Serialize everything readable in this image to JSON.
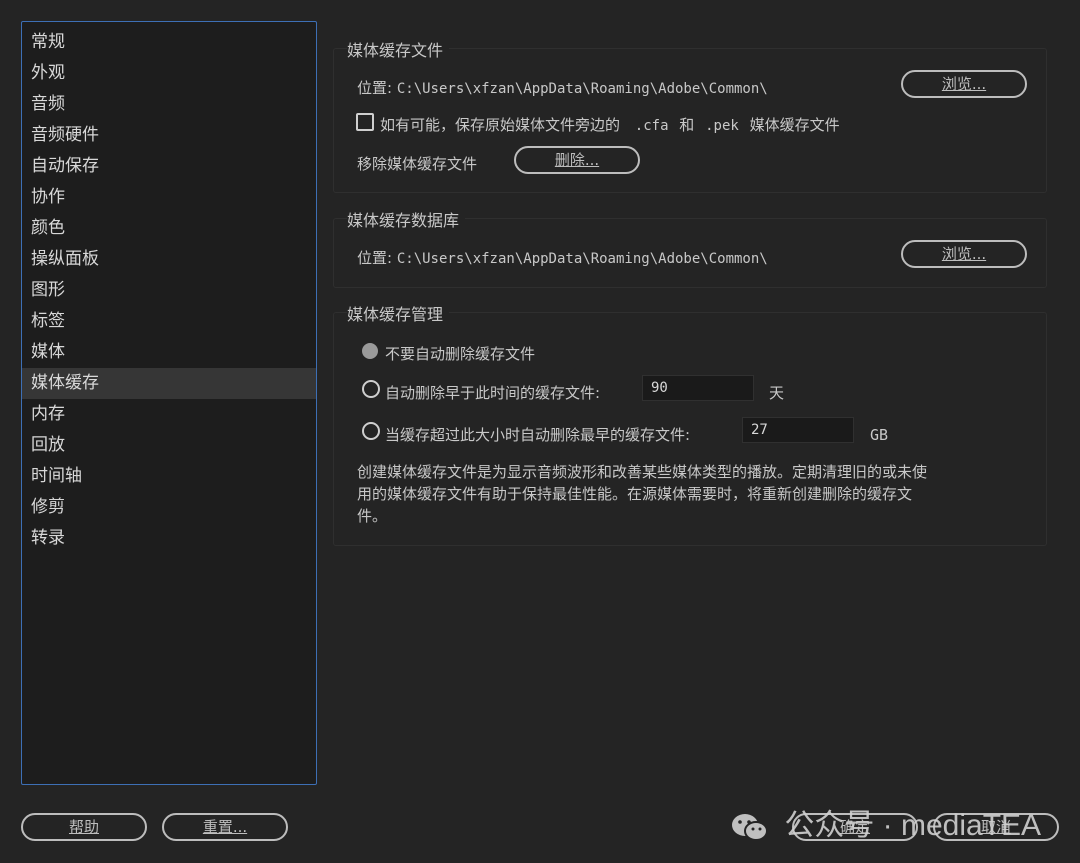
{
  "sidebar": {
    "items": [
      {
        "label": "常规"
      },
      {
        "label": "外观"
      },
      {
        "label": "音频"
      },
      {
        "label": "音频硬件"
      },
      {
        "label": "自动保存"
      },
      {
        "label": "协作"
      },
      {
        "label": "颜色"
      },
      {
        "label": "操纵面板"
      },
      {
        "label": "图形"
      },
      {
        "label": "标签"
      },
      {
        "label": "媒体"
      },
      {
        "label": "媒体缓存"
      },
      {
        "label": "内存"
      },
      {
        "label": "回放"
      },
      {
        "label": "时间轴"
      },
      {
        "label": "修剪"
      },
      {
        "label": "转录"
      }
    ],
    "selected": "媒体缓存"
  },
  "media_cache_files": {
    "title": "媒体缓存文件",
    "location_label": "位置:",
    "location_path": "C:\\Users\\xfzan\\AppData\\Roaming\\Adobe\\Common\\",
    "browse_label": "浏览...",
    "save_next_label": "如有可能，保存原始媒体文件旁边的",
    "ext_cfa": ".cfa",
    "and_label": "和",
    "ext_pek": ".pek",
    "save_next_suffix": "媒体缓存文件",
    "remove_label": "移除媒体缓存文件",
    "delete_label": "删除..."
  },
  "media_cache_db": {
    "title": "媒体缓存数据库",
    "location_label": "位置:",
    "location_path": "C:\\Users\\xfzan\\AppData\\Roaming\\Adobe\\Common\\",
    "browse_label": "浏览..."
  },
  "media_cache_mgmt": {
    "title": "媒体缓存管理",
    "opt_no_delete": "不要自动删除缓存文件",
    "opt_older_than": "自动删除早于此时间的缓存文件:",
    "older_than_value": "90",
    "older_than_unit": "天",
    "opt_exceeds_size": "当缓存超过此大小时自动删除最早的缓存文件:",
    "size_value": "27",
    "size_unit": "GB",
    "description": "创建媒体缓存文件是为显示音频波形和改善某些媒体类型的播放。定期清理旧的或未使用的媒体缓存文件有助于保持最佳性能。在源媒体需要时，将重新创建删除的缓存文件。"
  },
  "footer": {
    "help_label": "帮助",
    "reset_label": "重置...",
    "ok_label": "确定",
    "cancel_label": "取消"
  },
  "watermark": {
    "text": "公众号 · mediaTEA"
  }
}
